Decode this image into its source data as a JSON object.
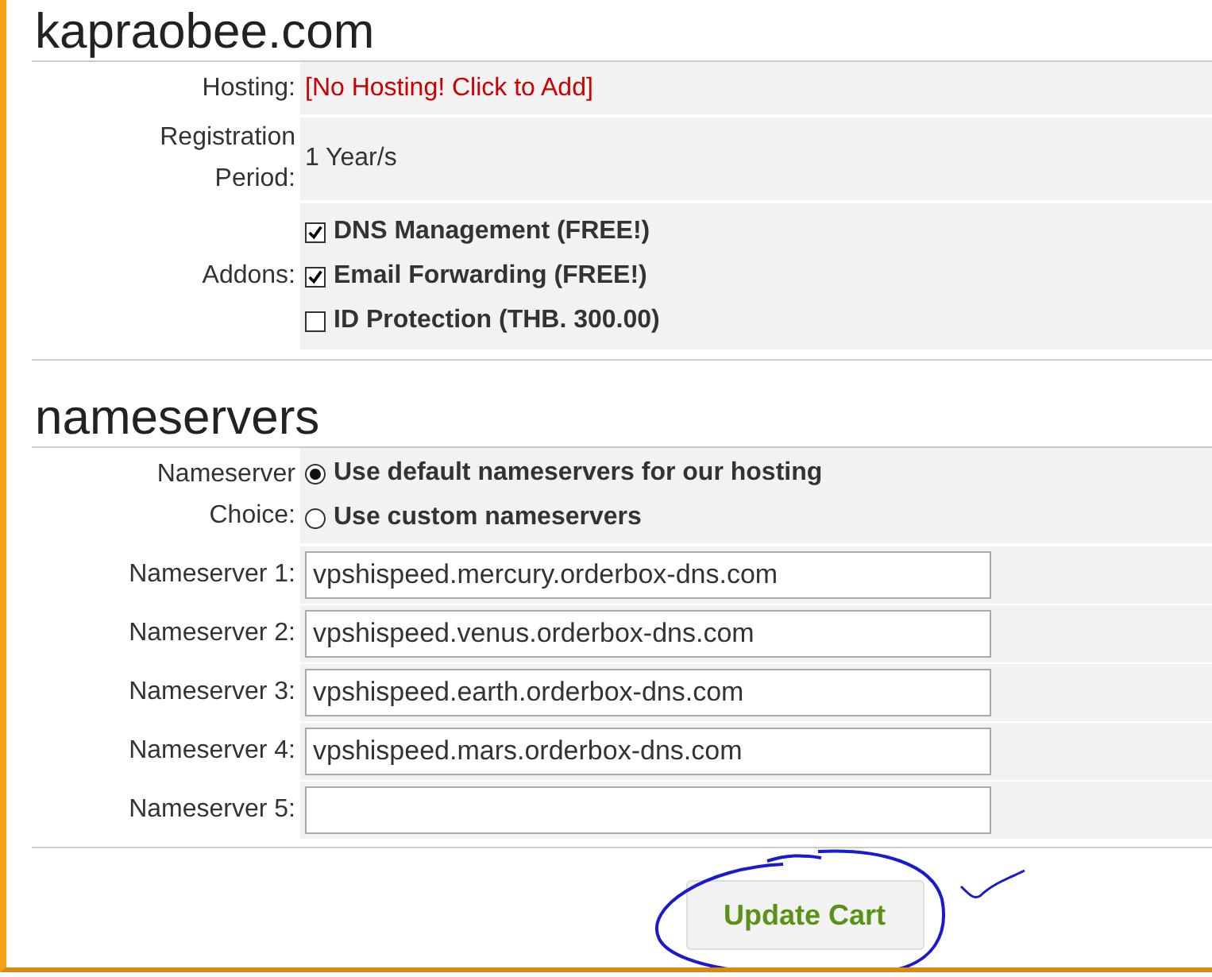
{
  "domain": {
    "title": "kapraobee.com",
    "hosting": {
      "label": "Hosting:",
      "value": "[No Hosting! Click to Add]"
    },
    "registration": {
      "label_lines": [
        "Registration",
        "Period:"
      ],
      "value": "1 Year/s"
    },
    "addons": {
      "label": "Addons:",
      "items": [
        {
          "label": "DNS Management (FREE!)",
          "checked": true
        },
        {
          "label": "Email Forwarding (FREE!)",
          "checked": true
        },
        {
          "label": "ID Protection (THB. 300.00)",
          "checked": false
        }
      ]
    }
  },
  "nameservers": {
    "title": "nameservers",
    "choice": {
      "label_lines": [
        "Nameserver",
        "Choice:"
      ],
      "options": [
        {
          "label": "Use default nameservers for our hosting",
          "selected": true
        },
        {
          "label": "Use custom nameservers",
          "selected": false
        }
      ]
    },
    "fields": [
      {
        "label": "Nameserver 1:",
        "value": "vpshispeed.mercury.orderbox-dns.com"
      },
      {
        "label": "Nameserver 2:",
        "value": "vpshispeed.venus.orderbox-dns.com"
      },
      {
        "label": "Nameserver 3:",
        "value": "vpshispeed.earth.orderbox-dns.com"
      },
      {
        "label": "Nameserver 4:",
        "value": "vpshispeed.mars.orderbox-dns.com"
      },
      {
        "label": "Nameserver 5:"
      }
    ]
  },
  "update_button": "Update Cart"
}
